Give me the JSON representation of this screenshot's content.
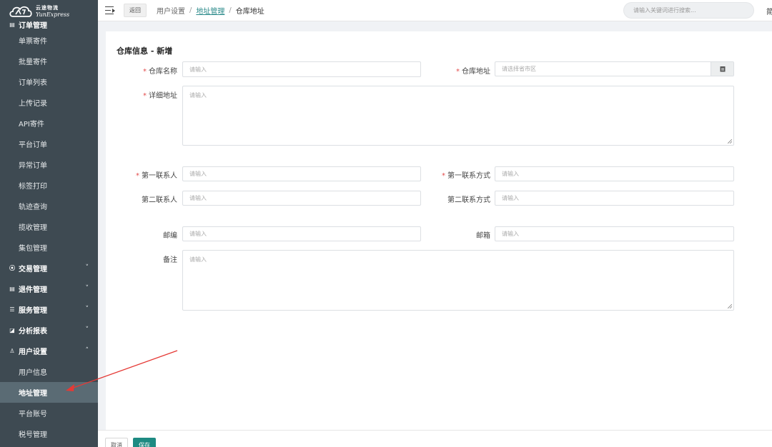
{
  "brand": {
    "name_cn": "云途物流",
    "name_en": "YunExpress"
  },
  "sidebar": {
    "partial_group": {
      "label": "订单管理",
      "icon": "order-icon"
    },
    "order_items": [
      "单票寄件",
      "批量寄件",
      "订单列表",
      "上传记录",
      "API寄件",
      "平台订单",
      "异常订单",
      "标签打印",
      "轨迹查询",
      "揽收管理",
      "集包管理"
    ],
    "groups": [
      {
        "label": "交易管理",
        "icon": "trade-icon",
        "expanded": false
      },
      {
        "label": "退件管理",
        "icon": "return-icon",
        "expanded": false
      },
      {
        "label": "服务管理",
        "icon": "service-icon",
        "expanded": false
      },
      {
        "label": "分析报表",
        "icon": "report-icon",
        "expanded": false
      },
      {
        "label": "用户设置",
        "icon": "user-icon",
        "expanded": true
      }
    ],
    "user_items": [
      "用户信息",
      "地址管理",
      "平台账号",
      "税号管理"
    ],
    "active_item": "地址管理"
  },
  "topbar": {
    "back_label": "返回",
    "breadcrumb": [
      "用户设置",
      "地址管理",
      "仓库地址"
    ],
    "search_placeholder": "请输入关键词进行搜索...",
    "edge_text": "简"
  },
  "form": {
    "title": "仓库信息 - 新增",
    "placeholder": "请输入",
    "fields": {
      "warehouse_name": "仓库名称",
      "warehouse_address": "仓库地址",
      "address_placeholder": "请选择省市区",
      "detail_address": "详细地址",
      "contact1": "第一联系人",
      "contact1_phone": "第一联系方式",
      "contact2": "第二联系人",
      "contact2_phone": "第二联系方式",
      "zipcode": "邮编",
      "email": "邮箱",
      "remark": "备注"
    },
    "required_mark": "*"
  },
  "footer": {
    "cancel_label": "取消",
    "save_label": "保存"
  },
  "colors": {
    "sidebar_bg": "#3e4a52",
    "active_bg": "#5a6b74",
    "accent": "#1e8a82",
    "required": "#e34c4c",
    "arrow": "#e53935"
  }
}
